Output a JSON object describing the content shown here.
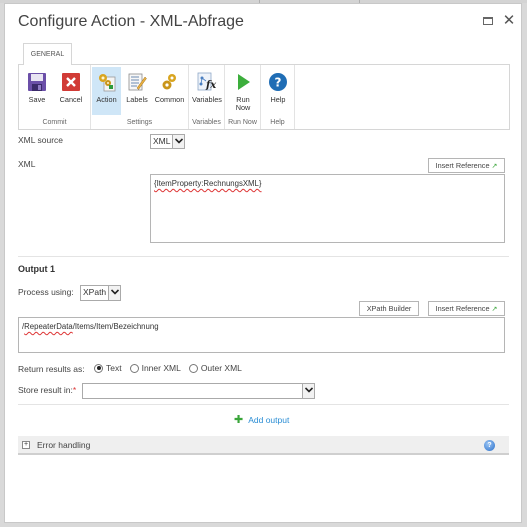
{
  "window": {
    "title": "Configure Action - XML-Abfrage",
    "maximize_icon": "maximize-icon",
    "close_icon": "close-icon",
    "close_glyph": "✕"
  },
  "ribbon": {
    "tab": "GENERAL",
    "groups": [
      {
        "label": "Commit",
        "buttons": [
          {
            "label": "Save",
            "icon": "save-icon"
          },
          {
            "label": "Cancel",
            "icon": "cancel-icon"
          }
        ]
      },
      {
        "label": "Settings",
        "buttons": [
          {
            "label": "Action",
            "icon": "action-gears-icon",
            "active": true
          },
          {
            "label": "Labels",
            "icon": "labels-icon"
          },
          {
            "label": "Common",
            "icon": "common-gears-icon"
          }
        ]
      },
      {
        "label": "Variables",
        "buttons": [
          {
            "label": "Variables",
            "icon": "variables-fx-icon"
          }
        ]
      },
      {
        "label": "Run Now",
        "buttons": [
          {
            "label": "Run Now",
            "icon": "run-play-icon"
          }
        ]
      },
      {
        "label": "Help",
        "buttons": [
          {
            "label": "Help",
            "icon": "help-icon"
          }
        ]
      }
    ]
  },
  "form": {
    "xml_source_label": "XML source",
    "xml_source_value": "XML",
    "xml_label": "XML",
    "insert_reference_label": "Insert Reference",
    "xml_value": "{ItemProperty:RechnungsXML}"
  },
  "output": {
    "title": "Output 1",
    "process_using_label": "Process using:",
    "process_using_value": "XPath",
    "xpath_builder_label": "XPath Builder",
    "insert_reference_label": "Insert Reference",
    "xpath_prefix": "/",
    "xpath_misspelled": "RepeaterData",
    "xpath_rest": "/Items/Item/Bezeichnung",
    "return_results_label": "Return results as:",
    "return_options": [
      {
        "label": "Text",
        "checked": true
      },
      {
        "label": "Inner XML",
        "checked": false
      },
      {
        "label": "Outer XML",
        "checked": false
      }
    ],
    "store_result_label": "Store result in:",
    "required_marker": "*",
    "store_result_value": ""
  },
  "add_output_label": "Add output",
  "add_output_glyph": "✚",
  "error_handling": {
    "label": "Error handling",
    "expander_glyph": "+",
    "help_glyph": "?"
  }
}
